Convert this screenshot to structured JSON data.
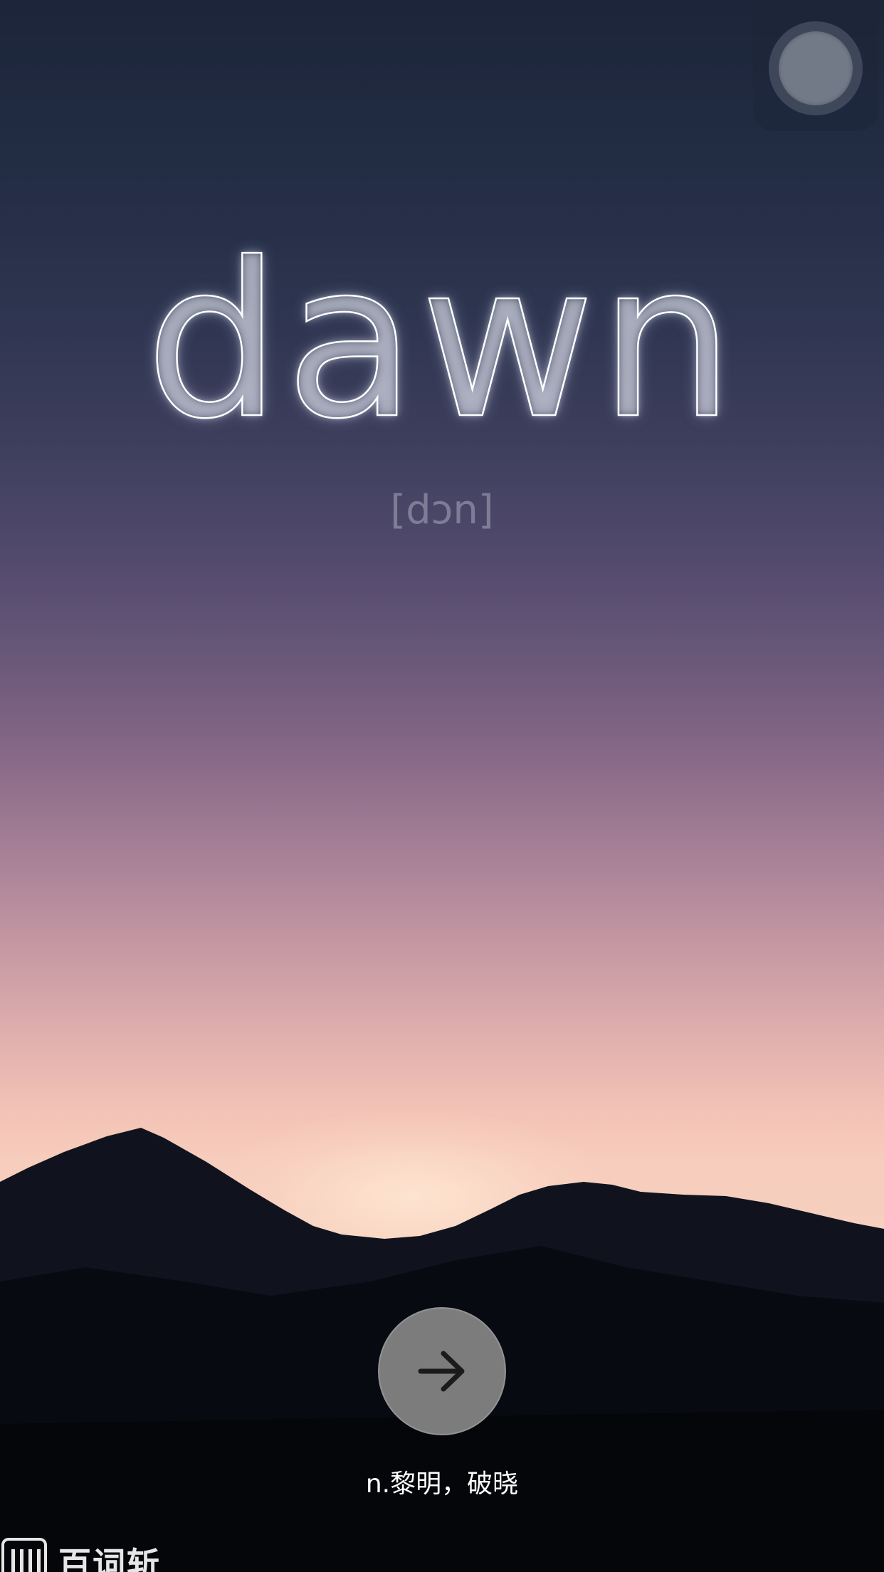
{
  "word": {
    "text": "dawn",
    "phonetic": "[dɔn]",
    "meaning": "n.黎明，破晓"
  },
  "controls": {
    "next_icon": "arrow-right-icon",
    "assistive_touch_icon": "assistive-touch-icon"
  },
  "brand": {
    "name": "百词斩",
    "logo_icon": "baicizhan-logo-icon"
  },
  "colors": {
    "sky_top": "#1c2539",
    "sky_horizon": "#f7cdbd",
    "mountains": "#0b0d14",
    "button": "#7c7c7c",
    "word_outline": "#ffffff"
  }
}
